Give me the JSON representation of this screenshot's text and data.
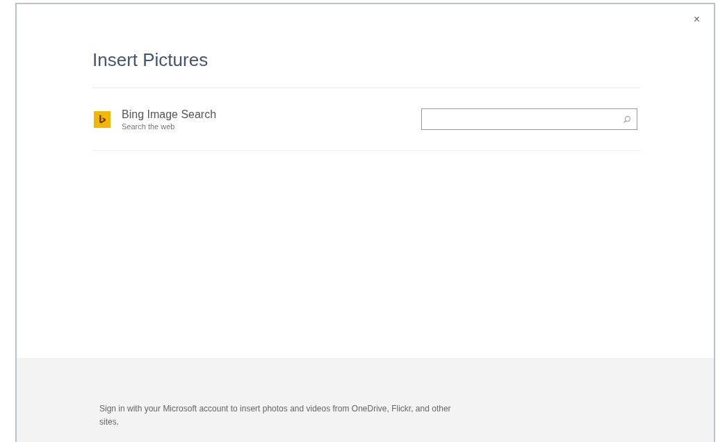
{
  "dialog": {
    "title": "Insert Pictures",
    "close": "×"
  },
  "sources": [
    {
      "name": "Bing Image Search",
      "description": "Search the web"
    }
  ],
  "footer": {
    "text": "Sign in with your Microsoft account to insert photos and videos from OneDrive, Flickr, and other sites."
  }
}
